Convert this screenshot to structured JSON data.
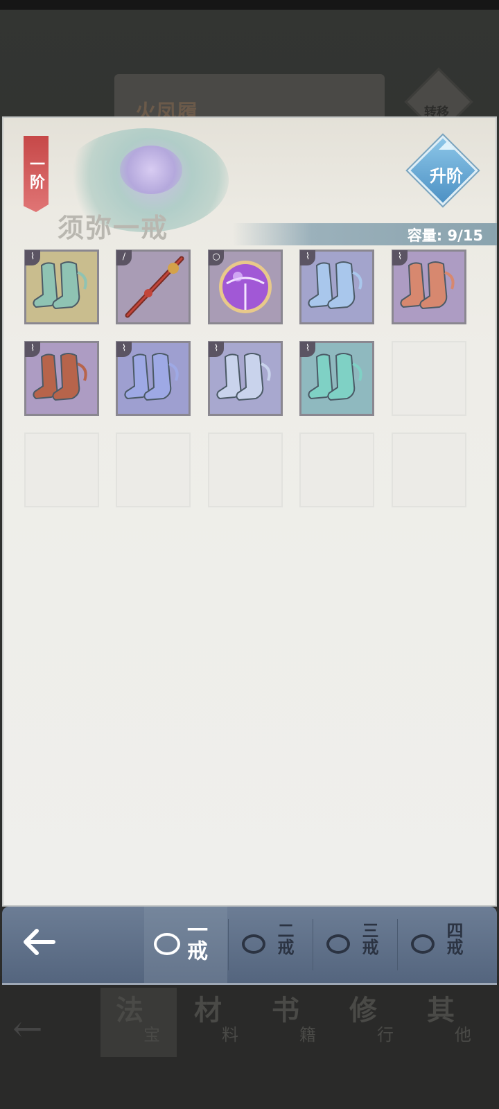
{
  "background": {
    "card_title": "火凤履",
    "transfer_label": "转移",
    "tabs": [
      {
        "big": "法",
        "small": "宝",
        "active": true
      },
      {
        "big": "材",
        "small": "料",
        "active": false
      },
      {
        "big": "书",
        "small": "籍",
        "active": false
      },
      {
        "big": "修",
        "small": "行",
        "active": false
      },
      {
        "big": "其",
        "small": "他",
        "active": false
      }
    ]
  },
  "panel": {
    "tier": "一阶",
    "ring_name": "须弥一戒",
    "capacity": "容量: 9/15",
    "upgrade_label": "升阶"
  },
  "slots": [
    {
      "item": "boots",
      "category_icon": "boot-icon",
      "tint": "#c9bd8e",
      "color": "#8fc3b3"
    },
    {
      "item": "staff",
      "category_icon": "weapon-icon",
      "tint": "#a99cb5",
      "color": "#c2453a"
    },
    {
      "item": "orb",
      "category_icon": "ring-icon",
      "tint": "#a99cb5",
      "color": "#a158d6"
    },
    {
      "item": "boots",
      "category_icon": "boot-icon",
      "tint": "#a3a4cc",
      "color": "#a9c7ec"
    },
    {
      "item": "boots",
      "category_icon": "boot-icon",
      "tint": "#ad9cc3",
      "color": "#d7886f"
    },
    {
      "item": "boots",
      "category_icon": "boot-icon",
      "tint": "#ad9cc3",
      "color": "#b7644b"
    },
    {
      "item": "boots",
      "category_icon": "boot-icon",
      "tint": "#9e9fd0",
      "color": "#9ea9e5"
    },
    {
      "item": "boots",
      "category_icon": "boot-icon",
      "tint": "#a8a8cf",
      "color": "#c9d3ec"
    },
    {
      "item": "boots",
      "category_icon": "boot-icon",
      "tint": "#8fb9bf",
      "color": "#7fd1c5"
    },
    {
      "item": null
    },
    {
      "item": null
    },
    {
      "item": null
    },
    {
      "item": null
    },
    {
      "item": null
    },
    {
      "item": null
    }
  ],
  "ring_tabs": [
    {
      "label": "一戒",
      "active": true
    },
    {
      "label": "二戒",
      "active": false
    },
    {
      "label": "三戒",
      "active": false
    },
    {
      "label": "四戒",
      "active": false
    }
  ],
  "colors": {
    "tier_red": "#c64848",
    "upgrade_blue": "#4d91c4",
    "tab_bar": "#5e6f88"
  }
}
